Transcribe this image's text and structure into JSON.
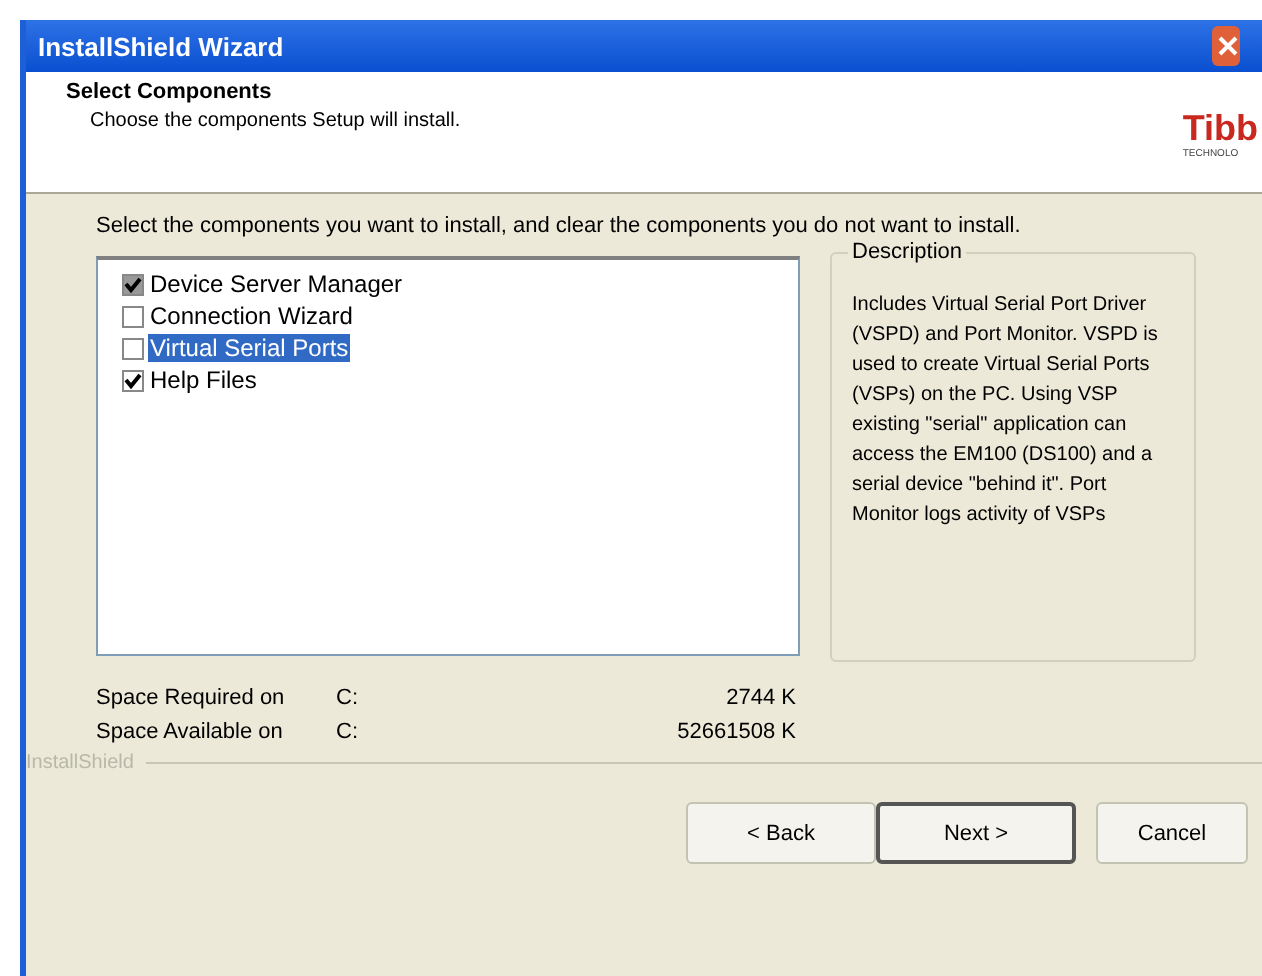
{
  "window": {
    "title": "InstallShield Wizard"
  },
  "header": {
    "title": "Select Components",
    "subtitle": "Choose the components Setup will install.",
    "logo": "Tibb",
    "logo_sub": "TECHNOLO"
  },
  "instruction": "Select the components you want to install, and clear the components you do not want to install.",
  "components": [
    {
      "label": "Device Server Manager",
      "checked": true,
      "partial": true,
      "selected": false
    },
    {
      "label": "Connection Wizard",
      "checked": false,
      "partial": false,
      "selected": false
    },
    {
      "label": "Virtual Serial Ports",
      "checked": false,
      "partial": false,
      "selected": true
    },
    {
      "label": "Help Files",
      "checked": true,
      "partial": false,
      "selected": false
    }
  ],
  "description": {
    "title": "Description",
    "text": "Includes Virtual Serial Port Driver (VSPD) and Port Monitor. VSPD is used to create Virtual Serial Ports (VSPs) on the PC. Using VSP existing \"serial\" application can access the EM100 (DS100) and a serial device \"behind it\". Port Monitor logs activity of VSPs"
  },
  "space": [
    {
      "label": "Space Required on",
      "drive": "C:",
      "value": "2744 K"
    },
    {
      "label": "Space Available on",
      "drive": "C:",
      "value": "52661508 K"
    }
  ],
  "brand": "InstallShield",
  "buttons": [
    {
      "label": "< Back",
      "default": false
    },
    {
      "label": "Next >",
      "default": true
    },
    {
      "label": "Cancel",
      "default": false
    }
  ]
}
